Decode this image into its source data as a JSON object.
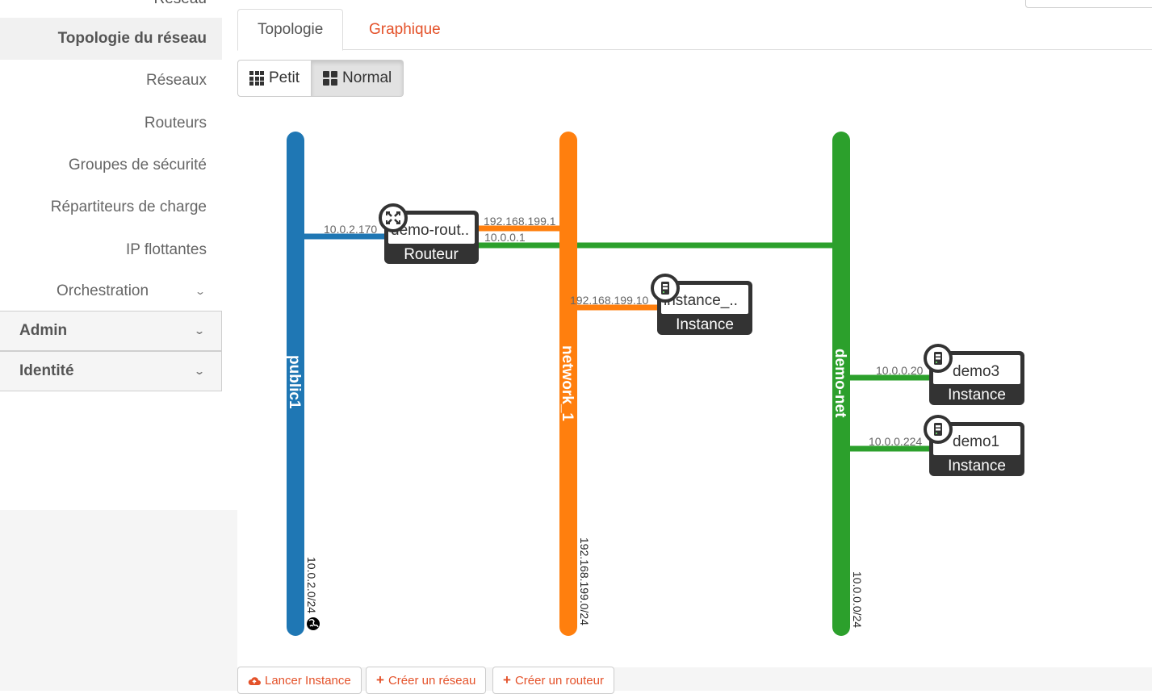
{
  "sidebar": {
    "cut_label": "Réseau",
    "items": [
      {
        "label": "Topologie du réseau",
        "active": true
      },
      {
        "label": "Réseaux"
      },
      {
        "label": "Routeurs"
      },
      {
        "label": "Groupes de sécurité"
      },
      {
        "label": "Répartiteurs de charge"
      },
      {
        "label": "IP flottantes"
      }
    ],
    "orchestration": "Orchestration",
    "dashboards": [
      "Admin",
      "Identité"
    ]
  },
  "tabs": [
    "Topologie",
    "Graphique"
  ],
  "size_buttons": [
    "Petit",
    "Normal"
  ],
  "networks": [
    {
      "name": "public1",
      "cidr": "10.0.2.0/24",
      "color": "#1f77b4",
      "external": true
    },
    {
      "name": "network_1",
      "cidr": "192.168.199.0/24",
      "color": "#ff7f0e"
    },
    {
      "name": "demo-net",
      "cidr": "10.0.0.0/24",
      "color": "#2ca02c"
    }
  ],
  "devices": [
    {
      "name": "demo-rout..",
      "type": "Routeur",
      "icon": "router-icon"
    },
    {
      "name": "instance_..",
      "type": "Instance",
      "icon": "server-icon"
    },
    {
      "name": "demo3",
      "type": "Instance",
      "icon": "server-icon"
    },
    {
      "name": "demo1",
      "type": "Instance",
      "icon": "server-icon"
    }
  ],
  "ports": [
    "10.0.2.170",
    "192.168.199.1",
    "10.0.0.1",
    "192.168.199.10",
    "10.0.0.20",
    "10.0.0.224"
  ],
  "actions": [
    "Lancer Instance",
    "Créer un réseau",
    "Créer un routeur"
  ],
  "colors": {
    "accent": "#e4522a",
    "device_dark": "#333333"
  }
}
